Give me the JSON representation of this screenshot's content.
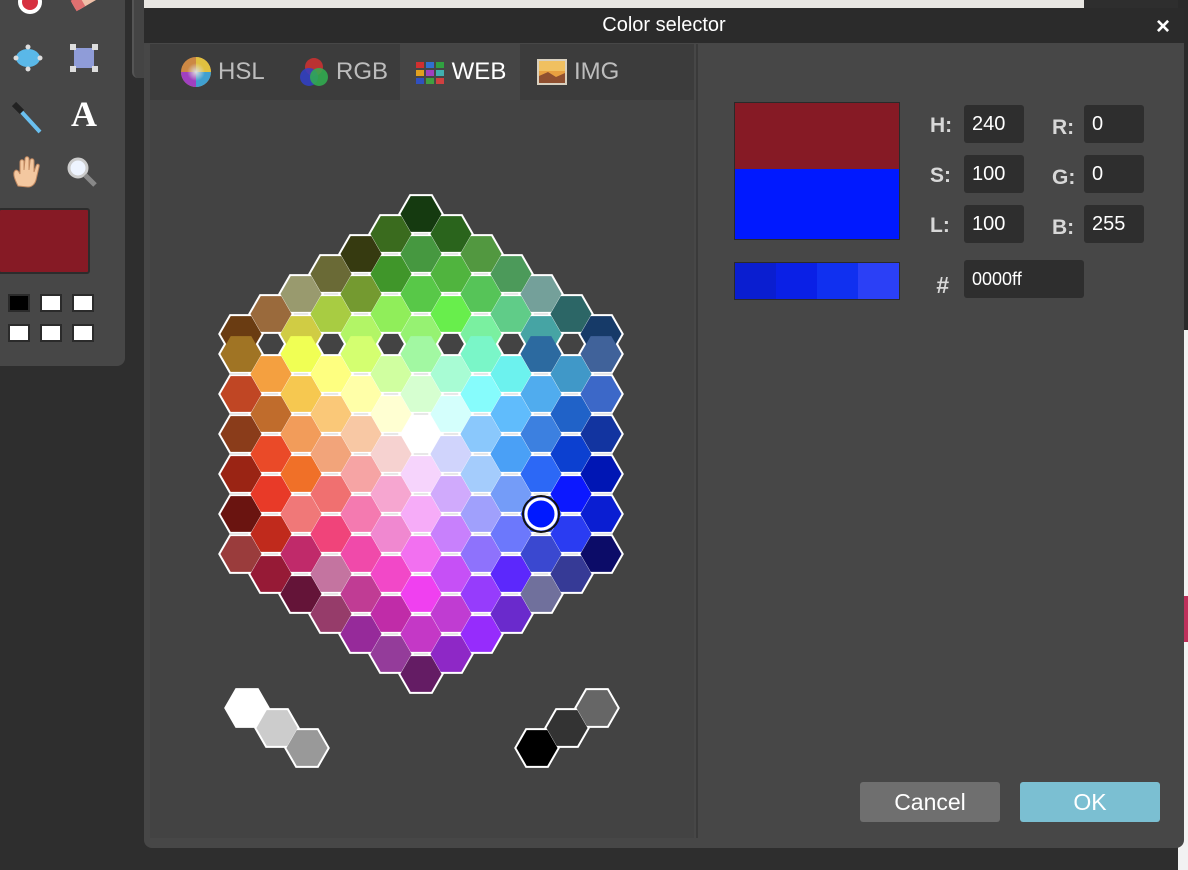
{
  "dialog": {
    "title": "Color selector",
    "close_label": "×",
    "tabs": [
      {
        "label": "HSL",
        "active": false
      },
      {
        "label": "RGB",
        "active": false
      },
      {
        "label": "WEB",
        "active": true
      },
      {
        "label": "IMG",
        "active": false
      }
    ],
    "fields": {
      "h_label": "H:",
      "h_value": "240",
      "s_label": "S:",
      "s_value": "100",
      "l_label": "L:",
      "l_value": "100",
      "r_label": "R:",
      "r_value": "0",
      "g_label": "G:",
      "g_value": "0",
      "b_label": "B:",
      "b_value": "255",
      "hex_label": "#",
      "hex_value": "0000ff"
    },
    "preview": {
      "old_color": "#861a25",
      "new_color": "#0019ff"
    },
    "shades": [
      "#0a1ed0",
      "#0a20e6",
      "#1030f0",
      "#2b40f6"
    ],
    "buttons": {
      "cancel": "Cancel",
      "ok": "OK"
    },
    "selected_swatch": {
      "row": 8,
      "col": 12
    }
  },
  "palette_rows": [
    [
      "#153a10"
    ],
    [
      "#3a6b1e",
      "#2a641c"
    ],
    [
      "#363a10",
      "#469840",
      "#529840"
    ],
    [
      "#6a6a36",
      "#40962a",
      "#50b43e",
      "#4c9a5a"
    ],
    [
      "#999a6e",
      "#749a30",
      "#58c848",
      "#56c458",
      "#74a09a"
    ],
    [
      "#9a6a3c",
      "#a8cc42",
      "#90ee5a",
      "#68ee4c",
      "#60cc88",
      "#2c6666"
    ],
    [
      "#6a3c12",
      "#d0cc44",
      "#b2f566",
      "#96f272",
      "#7af0a0",
      "#46a4a4",
      "#163a68"
    ],
    [
      "#a07424",
      "#f0ff54",
      "#d4ff70",
      "#a2f8a2",
      "#7af6c8",
      "#2c6aa0",
      "#40629a"
    ],
    [
      "#f4a040",
      "#feff80",
      "#d0ffa0",
      "#a8fcd4",
      "#6cf2ee",
      "#4098c8"
    ],
    [
      "#c04624",
      "#f6c850",
      "#ffffa8",
      "#d6ffd0",
      "#86fcfc",
      "#50acee",
      "#3c68c8"
    ],
    [
      "#c06c2c",
      "#fac878",
      "#ffffd2",
      "#d4fffc",
      "#60bcfc",
      "#2062c8"
    ],
    [
      "#8a3c1a",
      "#f29c5a",
      "#f8c8a4",
      "#ffffff",
      "#8ac8fc",
      "#3c80e0",
      "#1234a0"
    ],
    [
      "#ea4a28",
      "#f2a47a",
      "#f6d2d0",
      "#d0d4fc",
      "#4aa0f6",
      "#0c40d0"
    ],
    [
      "#9a2414",
      "#f07028",
      "#f6a4a4",
      "#f6d4fc",
      "#a4ccfc",
      "#2c68f6",
      "#0016b4"
    ],
    [
      "#e83a28",
      "#f07070",
      "#f6a6d0",
      "#d0aafc",
      "#749cf8",
      "#0c18ff"
    ],
    [
      "#6a1410",
      "#f07878",
      "#f47ab0",
      "#f6acf8",
      "#a0a0fc",
      "#3c5cfc",
      "#0a1ed2"
    ],
    [
      "#c02a1c",
      "#f0447a",
      "#f088d0",
      "#c880fc",
      "#6c78fc",
      "#2a3cf2"
    ],
    [
      "#9a3c3c",
      "#c02a6a",
      "#f04aaa",
      "#f270f0",
      "#8e72fc",
      "#3a48d0",
      "#0c0c68"
    ],
    [
      "#961a36",
      "#c474a0",
      "#f248c8",
      "#c650f6",
      "#5c28fc",
      "#363a96"
    ],
    [
      "#641438",
      "#c03c94",
      "#f040f0",
      "#963cfc",
      "#70709c"
    ],
    [
      "#963c6a",
      "#c02ca8",
      "#c03cd2",
      "#6a2acc"
    ],
    [
      "#962a9a",
      "#c438c6",
      "#962cfc"
    ],
    [
      "#943c9a",
      "#8e28c6"
    ],
    [
      "#641c64"
    ]
  ],
  "extra_swatches": [
    "#ffffff",
    "#cccccc",
    "#999999",
    "#000000",
    "#333333",
    "#666666"
  ],
  "editor": {
    "foreground_color": "#861a25",
    "mini_swatches": [
      "#000000",
      "#ffffff",
      "#ffffff",
      "#ffffff",
      "#ffffff",
      "#ffffff"
    ],
    "toolbar_text_icon": "A"
  }
}
